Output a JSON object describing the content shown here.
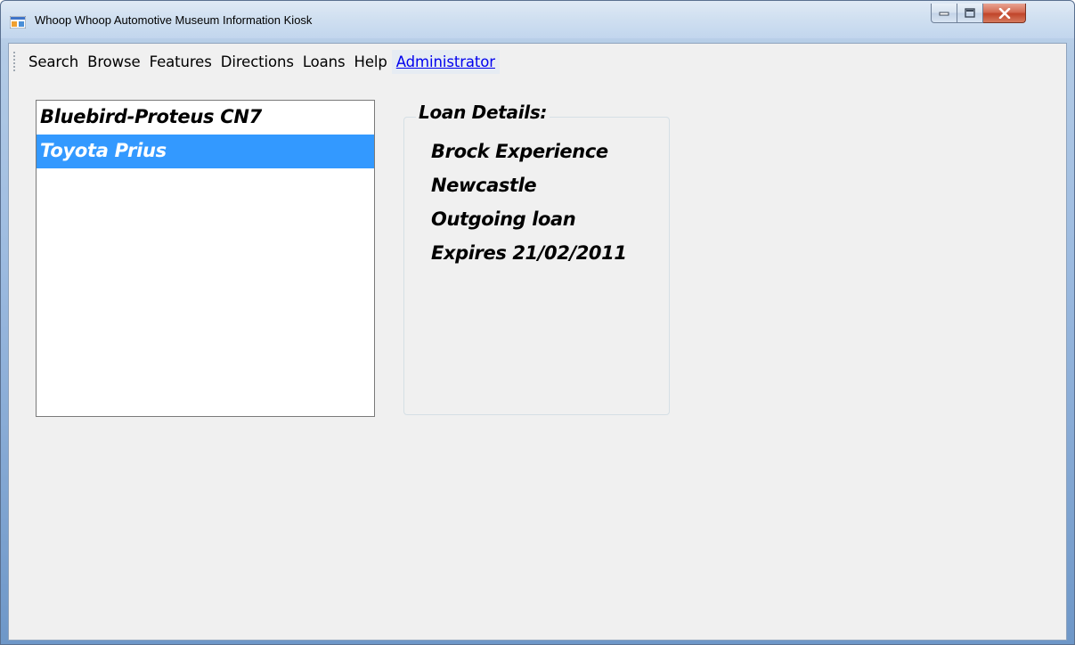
{
  "window": {
    "title": "Whoop Whoop Automotive Museum Information Kiosk",
    "icon": "app-form-icon"
  },
  "menu": {
    "items": [
      {
        "label": "Search",
        "type": "menu"
      },
      {
        "label": "Browse",
        "type": "menu"
      },
      {
        "label": "Features",
        "type": "menu"
      },
      {
        "label": "Directions",
        "type": "menu"
      },
      {
        "label": "Loans",
        "type": "menu"
      },
      {
        "label": "Help",
        "type": "menu"
      },
      {
        "label": "Administrator",
        "type": "link"
      }
    ]
  },
  "list": {
    "items": [
      {
        "label": "Bluebird-Proteus CN7",
        "selected": false
      },
      {
        "label": "Toyota Prius",
        "selected": true
      }
    ]
  },
  "loan_details": {
    "heading": "Loan Details:",
    "lines": [
      "Brock Experience",
      "Newcastle",
      "Outgoing loan",
      "Expires 21/02/2011"
    ]
  },
  "colors": {
    "selection": "#3399ff",
    "link": "#0000ee",
    "client_background": "#f0f0f0"
  }
}
